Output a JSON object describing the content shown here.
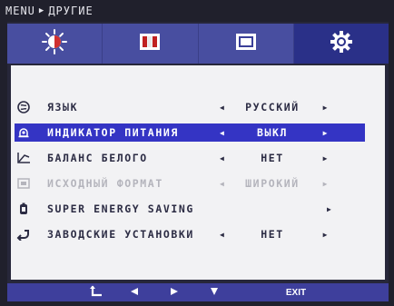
{
  "breadcrumb": {
    "root": "MENU",
    "current": "ДРУГИЕ"
  },
  "tabs": [
    {
      "name": "picture",
      "icon": "brightness-icon"
    },
    {
      "name": "color",
      "icon": "color-bars-icon"
    },
    {
      "name": "display",
      "icon": "screen-icon"
    },
    {
      "name": "other",
      "icon": "gear-icon",
      "active": true
    }
  ],
  "rows": [
    {
      "label": "ЯЗЫК",
      "value": "РУССКИЙ",
      "icon": "language-icon"
    },
    {
      "label": "ИНДИКАТОР ПИТАНИЯ",
      "value": "ВЫКЛ",
      "icon": "power-indicator-icon",
      "selected": true
    },
    {
      "label": "БАЛАНС БЕЛОГО",
      "value": "НЕТ",
      "icon": "white-balance-icon"
    },
    {
      "label": "ИСХОДНЫЙ ФОРМАТ",
      "value": "ШИРОКИЙ",
      "icon": "aspect-ratio-icon",
      "disabled": true
    },
    {
      "label": "SUPER ENERGY SAVING",
      "value": "",
      "icon": "energy-saving-icon"
    },
    {
      "label": "ЗАВОДСКИЕ УСТАНОВКИ",
      "value": "НЕТ",
      "icon": "reset-icon"
    }
  ],
  "buttons": {
    "exit": "EXIT"
  },
  "colors": {
    "tab": "#484ea0",
    "tab_active": "#2a3088",
    "selected_row": "#3434c4",
    "content_bg": "#f2f2f4"
  }
}
